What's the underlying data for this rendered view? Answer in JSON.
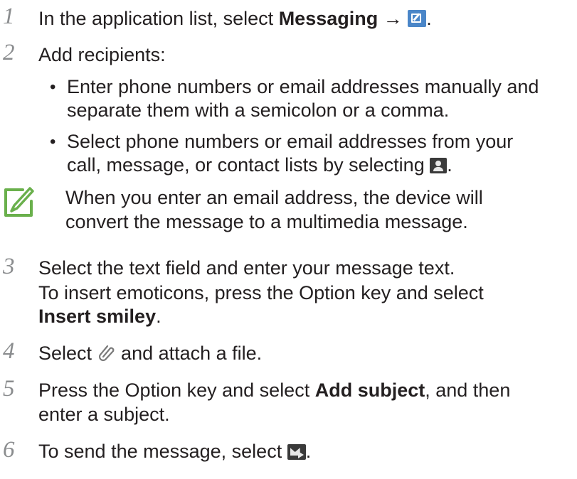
{
  "steps": [
    {
      "num": "1",
      "pre": "In the application list, select ",
      "bold": "Messaging",
      "arrow": " → ",
      "post": "."
    },
    {
      "num": "2",
      "text": "Add recipients:"
    },
    {
      "num": "3",
      "line1": "Select the text field and enter your message text.",
      "line2": "To insert emoticons, press the Option key and select",
      "bold": "Insert smiley",
      "post": "."
    },
    {
      "num": "4",
      "pre": "Select ",
      "post": " and attach a file."
    },
    {
      "num": "5",
      "pre": "Press the Option key and select ",
      "bold": "Add subject",
      "post": ", and then",
      "line2": "enter a subject."
    },
    {
      "num": "6",
      "pre": "To send the message, select ",
      "post": "."
    }
  ],
  "bullets": [
    {
      "line1": "Enter phone numbers or email addresses manually and",
      "line2": "separate them with a semicolon or a comma."
    },
    {
      "line1": "Select phone numbers or email addresses from your",
      "line2": "call, message, or contact lists by selecting ",
      "post": "."
    }
  ],
  "note": {
    "line1": "When you enter an email address, the device will",
    "line2": "convert the message to a multimedia message."
  },
  "icons": {
    "compose": "compose-icon",
    "contacts": "contacts-icon",
    "attach": "paperclip-icon",
    "send": "send-icon",
    "note": "note-pencil-icon"
  },
  "colors": {
    "note_icon": "#6ab04c",
    "compose_icon": "#4a86c8",
    "step_number": "#8a8c8e"
  }
}
